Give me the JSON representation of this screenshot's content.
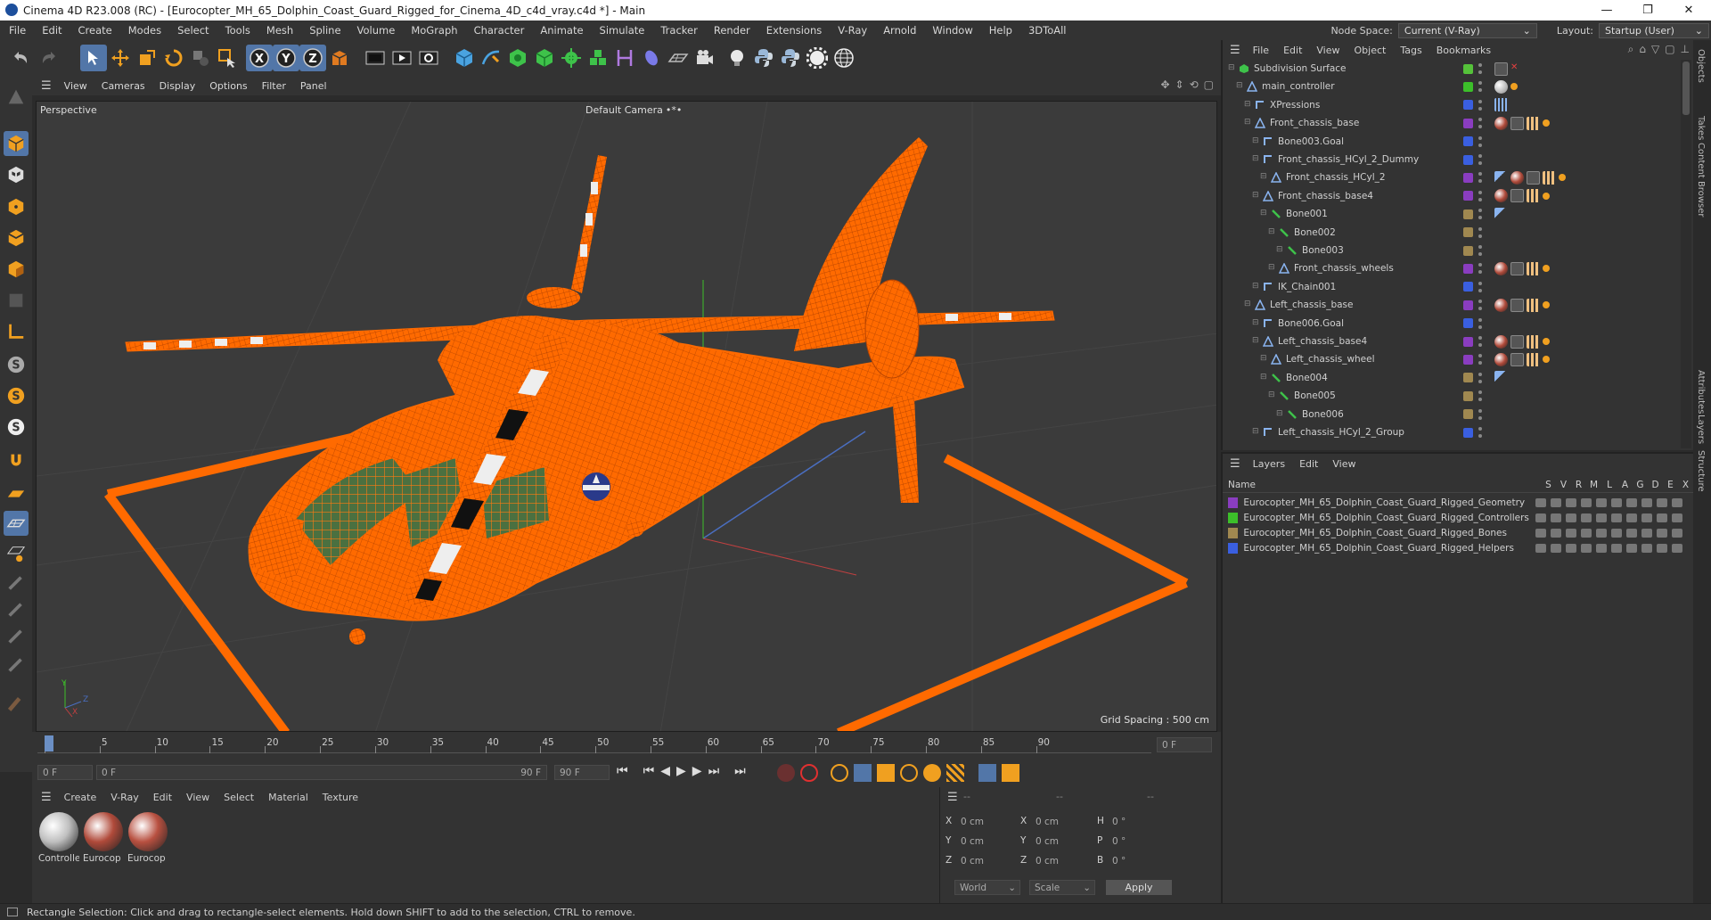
{
  "window": {
    "title": "Cinema 4D R23.008 (RC) - [Eurocopter_MH_65_Dolphin_Coast_Guard_Rigged_for_Cinema_4D_c4d_vray.c4d *] - Main",
    "minimize": "—",
    "maximize": "❐",
    "close": "✕"
  },
  "menubar": {
    "items": [
      "File",
      "Edit",
      "Create",
      "Modes",
      "Select",
      "Tools",
      "Mesh",
      "Spline",
      "Volume",
      "MoGraph",
      "Character",
      "Animate",
      "Simulate",
      "Tracker",
      "Render",
      "Extensions",
      "V-Ray",
      "Arnold",
      "Window",
      "Help",
      "3DToAll"
    ],
    "node_space_label": "Node Space:",
    "node_space_value": "Current (V-Ray)",
    "layout_label": "Layout:",
    "layout_value": "Startup (User)"
  },
  "viewport": {
    "menu": [
      "View",
      "Cameras",
      "Display",
      "Options",
      "Filter",
      "Panel"
    ],
    "view_name": "Perspective",
    "camera": "Default Camera",
    "camera_suffix": "•*•",
    "grid_spacing": "Grid Spacing : 500 cm",
    "axis_y": "Y",
    "axis_z": "Z",
    "axis_x": "X"
  },
  "timeline": {
    "ticks": [
      "0",
      "5",
      "10",
      "15",
      "20",
      "25",
      "30",
      "35",
      "40",
      "45",
      "50",
      "55",
      "60",
      "65",
      "70",
      "75",
      "80",
      "85",
      "90"
    ],
    "current_frame": "0 F"
  },
  "transport": {
    "start_field": "0 F",
    "range_start": "0 F",
    "range_end": "90 F",
    "end_field": "90 F"
  },
  "material_panel": {
    "menu": [
      "Create",
      "V-Ray",
      "Edit",
      "View",
      "Select",
      "Material",
      "Texture"
    ],
    "materials": [
      {
        "label": "Controlle",
        "color": "#bfbfbf"
      },
      {
        "label": "Eurocop",
        "color": "#b04a3a"
      },
      {
        "label": "Eurocop",
        "color": "#b85040"
      }
    ]
  },
  "coord_panel": {
    "header_left": "--",
    "header_mid": "--",
    "header_right": "--",
    "rows": [
      {
        "a": "X",
        "av": "0 cm",
        "b": "X",
        "bv": "0 cm",
        "c": "H",
        "cv": "0 °"
      },
      {
        "a": "Y",
        "av": "0 cm",
        "b": "Y",
        "bv": "0 cm",
        "c": "P",
        "cv": "0 °"
      },
      {
        "a": "Z",
        "av": "0 cm",
        "b": "Z",
        "bv": "0 cm",
        "c": "B",
        "cv": "0 °"
      }
    ],
    "space": "World",
    "mode": "Scale",
    "apply": "Apply"
  },
  "status": "Rectangle Selection: Click and drag to rectangle-select elements. Hold down SHIFT to add to the selection, CTRL to remove.",
  "object_panel": {
    "menu": [
      "File",
      "Edit",
      "View",
      "Object",
      "Tags",
      "Bookmarks"
    ],
    "rows": [
      {
        "name": "Subdivision Surface",
        "indent": 0,
        "icon": "subdivision-icon",
        "color": "#55c23a",
        "tags": [
          "check",
          "x"
        ]
      },
      {
        "name": "main_controller",
        "indent": 1,
        "icon": "null-icon",
        "color": "#3cbf2a",
        "tags": [
          "sphere",
          "dot"
        ]
      },
      {
        "name": "XPressions",
        "indent": 2,
        "icon": "bone-icon",
        "color": "#3a5fe0",
        "tags": [
          "xpresso"
        ]
      },
      {
        "name": "Front_chassis_base",
        "indent": 2,
        "icon": "null-icon",
        "color": "#8a3dc0",
        "tags": [
          "mat",
          "check",
          "grid",
          "dot"
        ]
      },
      {
        "name": "Bone003.Goal",
        "indent": 3,
        "icon": "bone-icon",
        "color": "#3a5fe0",
        "tags": []
      },
      {
        "name": "Front_chassis_HCyl_2_Dummy",
        "indent": 3,
        "icon": "bone-icon",
        "color": "#3a5fe0",
        "tags": []
      },
      {
        "name": "Front_chassis_HCyl_2",
        "indent": 4,
        "icon": "null-icon",
        "color": "#8a3dc0",
        "tags": [
          "ik",
          "mat",
          "check",
          "grid",
          "dot"
        ]
      },
      {
        "name": "Front_chassis_base4",
        "indent": 3,
        "icon": "null-icon",
        "color": "#8a3dc0",
        "tags": [
          "mat",
          "check",
          "grid",
          "dot"
        ]
      },
      {
        "name": "Bone001",
        "indent": 4,
        "icon": "bone-green-icon",
        "color": "#a08850",
        "tags": [
          "ik"
        ]
      },
      {
        "name": "Bone002",
        "indent": 5,
        "icon": "bone-green-icon",
        "color": "#a08850",
        "tags": []
      },
      {
        "name": "Bone003",
        "indent": 6,
        "icon": "bone-green-icon",
        "color": "#a08850",
        "tags": []
      },
      {
        "name": "Front_chassis_wheels",
        "indent": 5,
        "icon": "null-icon",
        "color": "#8a3dc0",
        "tags": [
          "mat",
          "check",
          "grid",
          "dot"
        ]
      },
      {
        "name": "IK_Chain001",
        "indent": 3,
        "icon": "bone-icon",
        "color": "#3a5fe0",
        "tags": []
      },
      {
        "name": "Left_chassis_base",
        "indent": 2,
        "icon": "null-icon",
        "color": "#8a3dc0",
        "tags": [
          "mat",
          "check",
          "grid",
          "dot"
        ]
      },
      {
        "name": "Bone006.Goal",
        "indent": 3,
        "icon": "bone-icon",
        "color": "#3a5fe0",
        "tags": []
      },
      {
        "name": "Left_chassis_base4",
        "indent": 3,
        "icon": "null-icon",
        "color": "#8a3dc0",
        "tags": [
          "mat",
          "check",
          "grid",
          "dot"
        ]
      },
      {
        "name": "Left_chassis_wheel",
        "indent": 4,
        "icon": "null-icon",
        "color": "#8a3dc0",
        "tags": [
          "mat",
          "check",
          "grid",
          "dot"
        ]
      },
      {
        "name": "Bone004",
        "indent": 4,
        "icon": "bone-green-icon",
        "color": "#a08850",
        "tags": [
          "ik"
        ]
      },
      {
        "name": "Bone005",
        "indent": 5,
        "icon": "bone-green-icon",
        "color": "#a08850",
        "tags": []
      },
      {
        "name": "Bone006",
        "indent": 6,
        "icon": "bone-green-icon",
        "color": "#a08850",
        "tags": []
      },
      {
        "name": "Left_chassis_HCyl_2_Group",
        "indent": 3,
        "icon": "bone-icon",
        "color": "#3a5fe0",
        "tags": []
      }
    ]
  },
  "layer_panel": {
    "menu": [
      "Layers",
      "Edit",
      "View"
    ],
    "col_name": "Name",
    "cols": [
      "S",
      "V",
      "R",
      "M",
      "L",
      "A",
      "G",
      "D",
      "E",
      "X"
    ],
    "rows": [
      {
        "name": "Eurocopter_MH_65_Dolphin_Coast_Guard_Rigged_Geometry",
        "color": "#8a3dc0"
      },
      {
        "name": "Eurocopter_MH_65_Dolphin_Coast_Guard_Rigged_Controllers",
        "color": "#3cbf2a"
      },
      {
        "name": "Eurocopter_MH_65_Dolphin_Coast_Guard_Rigged_Bones",
        "color": "#a08850"
      },
      {
        "name": "Eurocopter_MH_65_Dolphin_Coast_Guard_Rigged_Helpers",
        "color": "#3a5fe0"
      }
    ]
  },
  "side_tabs": [
    "Objects",
    "Takes",
    "Content Browser",
    "Attributes",
    "Layers",
    "Structure"
  ]
}
